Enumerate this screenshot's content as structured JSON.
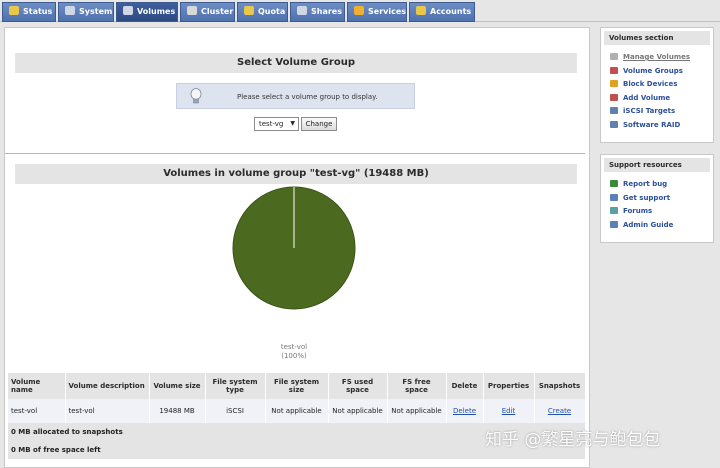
{
  "nav": {
    "tabs": [
      {
        "label": "Status",
        "icon": "status-icon",
        "color": "#e8c84a"
      },
      {
        "label": "System",
        "icon": "system-icon",
        "color": "#cfd7e6"
      },
      {
        "label": "Volumes",
        "icon": "volumes-icon",
        "color": "#cfd7e6"
      },
      {
        "label": "Cluster",
        "icon": "cluster-icon",
        "color": "#d9d9d9"
      },
      {
        "label": "Quota",
        "icon": "quota-icon",
        "color": "#e8c84a"
      },
      {
        "label": "Shares",
        "icon": "shares-icon",
        "color": "#cfd7e6"
      },
      {
        "label": "Services",
        "icon": "services-icon",
        "color": "#f0b030"
      },
      {
        "label": "Accounts",
        "icon": "accounts-icon",
        "color": "#e8c84a"
      }
    ],
    "active": "Volumes"
  },
  "select_section": {
    "title": "Select Volume Group",
    "info": "Please select a volume group to display.",
    "selected_vg": "test-vg",
    "button": "Change"
  },
  "volumes_section": {
    "title": "Volumes in volume group \"test-vg\" (19488 MB)"
  },
  "chart_data": {
    "type": "pie",
    "slices": [
      {
        "label": "test-vol",
        "value": 100,
        "color": "#4c6a1f"
      }
    ],
    "labels": [
      "test-vol",
      "(100%)"
    ]
  },
  "table": {
    "headers": [
      "Volume name",
      "Volume description",
      "Volume size",
      "File system type",
      "File system size",
      "FS used space",
      "FS free space",
      "Delete",
      "Properties",
      "Snapshots"
    ],
    "rows": [
      {
        "name": "test-vol",
        "description": "test-vol",
        "size": "19488 MB",
        "fs_type": "iSCSI",
        "fs_size": "Not applicable",
        "fs_used": "Not applicable",
        "fs_free": "Not applicable",
        "delete": "Delete",
        "properties": "Edit",
        "snapshots": "Create"
      }
    ],
    "snapshots_alloc": "0 MB allocated to snapshots",
    "free_space": "0 MB of free space left"
  },
  "sidebar": {
    "volumes": {
      "title": "Volumes section",
      "items": [
        {
          "label": "Manage Volumes",
          "icon": "disk-icon",
          "color": "#b0b0b0"
        },
        {
          "label": "Volume Groups",
          "icon": "volume-groups-icon",
          "color": "#c0504d"
        },
        {
          "label": "Block Devices",
          "icon": "block-devices-icon",
          "color": "#e0a020"
        },
        {
          "label": "Add Volume",
          "icon": "add-volume-icon",
          "color": "#c0504d"
        },
        {
          "label": "iSCSI Targets",
          "icon": "iscsi-targets-icon",
          "color": "#6080b0"
        },
        {
          "label": "Software RAID",
          "icon": "software-raid-icon",
          "color": "#6080b0"
        }
      ]
    },
    "support": {
      "title": "Support resources",
      "items": [
        {
          "label": "Report bug",
          "icon": "bug-icon",
          "color": "#3a8a3a"
        },
        {
          "label": "Get support",
          "icon": "support-icon",
          "color": "#5a80b8"
        },
        {
          "label": "Forums",
          "icon": "forums-icon",
          "color": "#5aa0a0"
        },
        {
          "label": "Admin Guide",
          "icon": "book-icon",
          "color": "#5a80b8"
        }
      ]
    }
  },
  "watermark": "知乎 @繁星亮与鲍包包"
}
